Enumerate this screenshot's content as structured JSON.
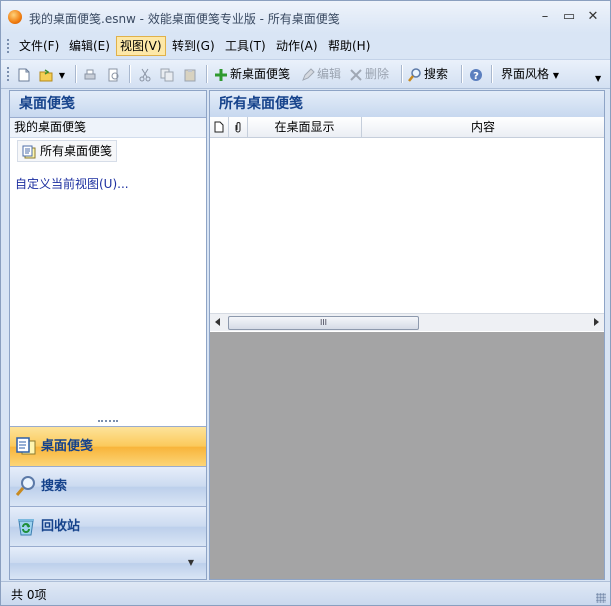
{
  "window": {
    "title": "我的桌面便笺.esnw - 效能桌面便笺专业版 - 所有桌面便笺",
    "controls": [
      "–",
      "▭",
      "✕"
    ]
  },
  "menubar": {
    "items": [
      {
        "label": "文件(F)"
      },
      {
        "label": "编辑(E)"
      },
      {
        "label": "视图(V)"
      },
      {
        "label": "转到(G)"
      },
      {
        "label": "工具(T)"
      },
      {
        "label": "动作(A)"
      },
      {
        "label": "帮助(H)"
      }
    ]
  },
  "toolbar": {
    "new_note": "新桌面便笺",
    "edit": "编辑",
    "delete": "删除",
    "search": "搜索",
    "theme": "界面风格"
  },
  "left_pane": {
    "header": "桌面便笺",
    "group": "我的桌面便笺",
    "item": "所有桌面便笺",
    "customize_link": "自定义当前视图(U)..."
  },
  "nav": {
    "notes": "桌面便笺",
    "search": "搜索",
    "recycle": "回收站"
  },
  "right_pane": {
    "header": "所有桌面便笺",
    "columns": [
      "在桌面显示",
      "内容"
    ],
    "scroll_thumb": "III"
  },
  "status": {
    "text": "共 0项"
  }
}
